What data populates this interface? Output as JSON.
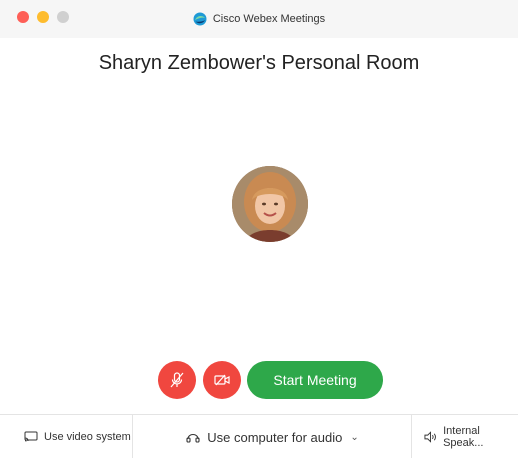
{
  "window": {
    "title": "Cisco Webex Meetings",
    "traffic_colors": {
      "close": "#fe5f57",
      "minimize": "#febc2e",
      "maximize": "#d0d0d0"
    }
  },
  "room": {
    "title": "Sharyn Zembower's Personal Room"
  },
  "controls": {
    "mute_icon": "mic-muted-icon",
    "video_icon": "video-off-icon",
    "start_label": "Start Meeting",
    "colors": {
      "danger": "#f0473f",
      "start": "#2ea84a"
    }
  },
  "bottombar": {
    "video_system_label": "Use video system",
    "audio_label": "Use computer for audio",
    "speaker_label": "Internal Speak..."
  }
}
